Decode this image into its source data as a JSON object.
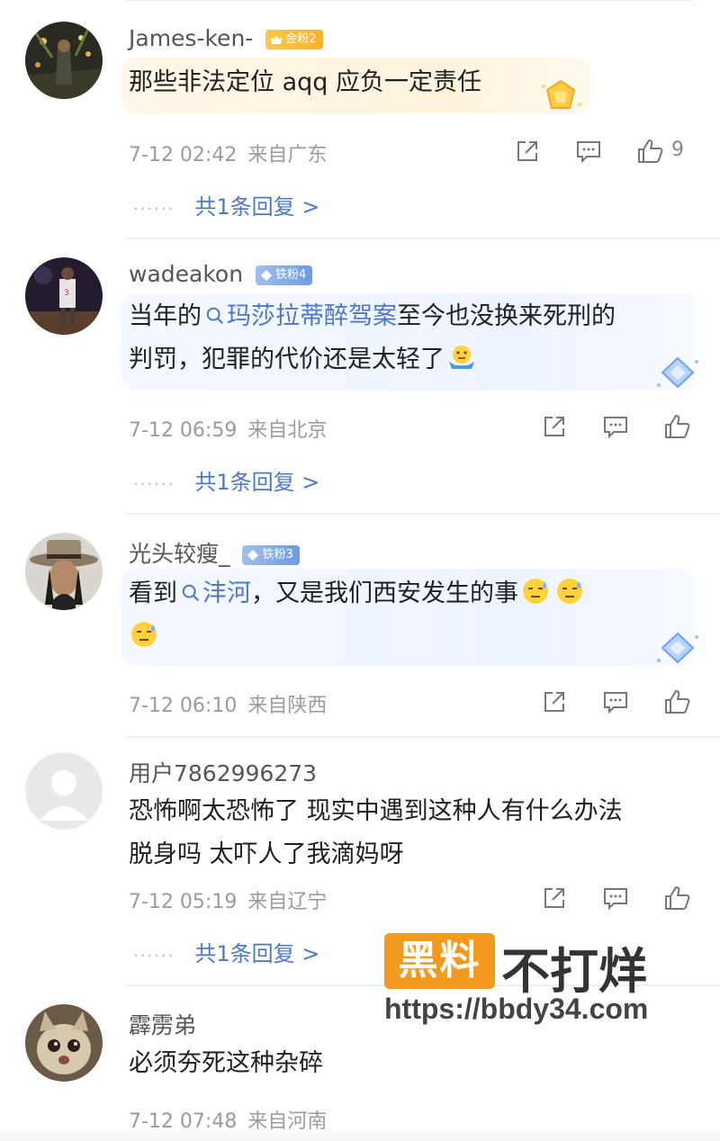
{
  "comments": [
    {
      "username": "James-ken-",
      "badge": "金粉2",
      "text_parts": [
        "那些非法定位 aqq 应负一定责任"
      ],
      "time": "7-12 02:42",
      "location": "来自广东",
      "likes": "9",
      "replies": "共1条回复 >"
    },
    {
      "username": "wadeakon",
      "badge": "铁粉4",
      "line1_prefix": "当年的",
      "line1_link": "玛莎拉蒂醉驾案",
      "line1_suffix": "至今也没换来死刑的",
      "line2": "判罚，犯罪的代价还是太轻了",
      "time": "7-12 06:59",
      "location": "来自北京",
      "replies": "共1条回复 >"
    },
    {
      "username": "光头较瘦_",
      "badge": "铁粉3",
      "line1_prefix": "看到",
      "line1_link": "沣河",
      "line1_suffix": "，又是我们西安发生的事",
      "time": "7-12 06:10",
      "location": "来自陕西"
    },
    {
      "username": "用户7862996273",
      "line1": "恐怖啊太恐怖了 现实中遇到这种人有什么办法",
      "line2": "脱身吗 太吓人了我滴妈呀",
      "time": "7-12 05:19",
      "location": "来自辽宁",
      "replies": "共1条回复 >"
    },
    {
      "username": "霹雳弟",
      "line1": "必须夯死这种杂碎",
      "time": "7-12 07:48",
      "location": "来自河南"
    }
  ],
  "watermark": {
    "box": "黑料",
    "title": "不打烊",
    "url": "https://bbdy34.com"
  },
  "icons": {
    "share": "share-icon",
    "comment": "comment-icon",
    "like": "like-icon",
    "search": "search-link-icon"
  },
  "colors": {
    "link": "#4b78c9",
    "gold_badge": "#ffb12b",
    "iron_badge": "#6f9be0",
    "watermark": "#f39a1e"
  }
}
